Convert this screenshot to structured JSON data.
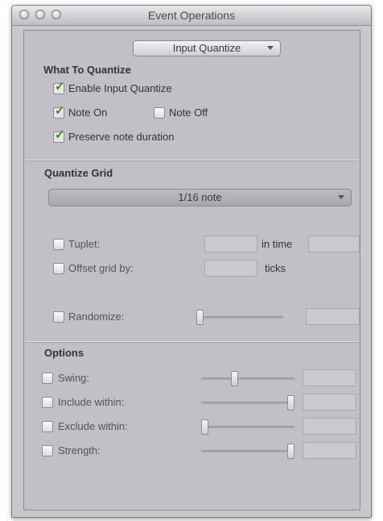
{
  "window": {
    "title": "Event Operations"
  },
  "operation_select": {
    "value": "Input Quantize"
  },
  "what_to_quantize": {
    "title": "What To Quantize",
    "options": [
      {
        "label": "Enable Input Quantize",
        "checked": true
      },
      {
        "label": "Note On",
        "checked": true
      },
      {
        "label": "Note Off",
        "checked": false
      },
      {
        "label": "Preserve note duration",
        "checked": true
      }
    ]
  },
  "quantize_grid": {
    "title": "Quantize Grid",
    "grid_value": "1/16 note",
    "tuplet": {
      "label": "Tuplet:",
      "suffix": "in time",
      "checked": false
    },
    "offset": {
      "label": "Offset grid by:",
      "suffix": "ticks",
      "checked": false
    },
    "randomize": {
      "label": "Randomize:",
      "checked": false,
      "slider_value": 0.0
    }
  },
  "options": {
    "title": "Options",
    "items": [
      {
        "label": "Swing:",
        "checked": false,
        "slider_value": 0.35
      },
      {
        "label": "Include within:",
        "checked": false,
        "slider_value": 1.0
      },
      {
        "label": "Exclude within:",
        "checked": false,
        "slider_value": 0.0
      },
      {
        "label": "Strength:",
        "checked": false,
        "slider_value": 1.0
      }
    ]
  },
  "colors": {
    "check": "#3d8a18",
    "panel": "#c2bfc6",
    "window": "#c9c6cc"
  }
}
